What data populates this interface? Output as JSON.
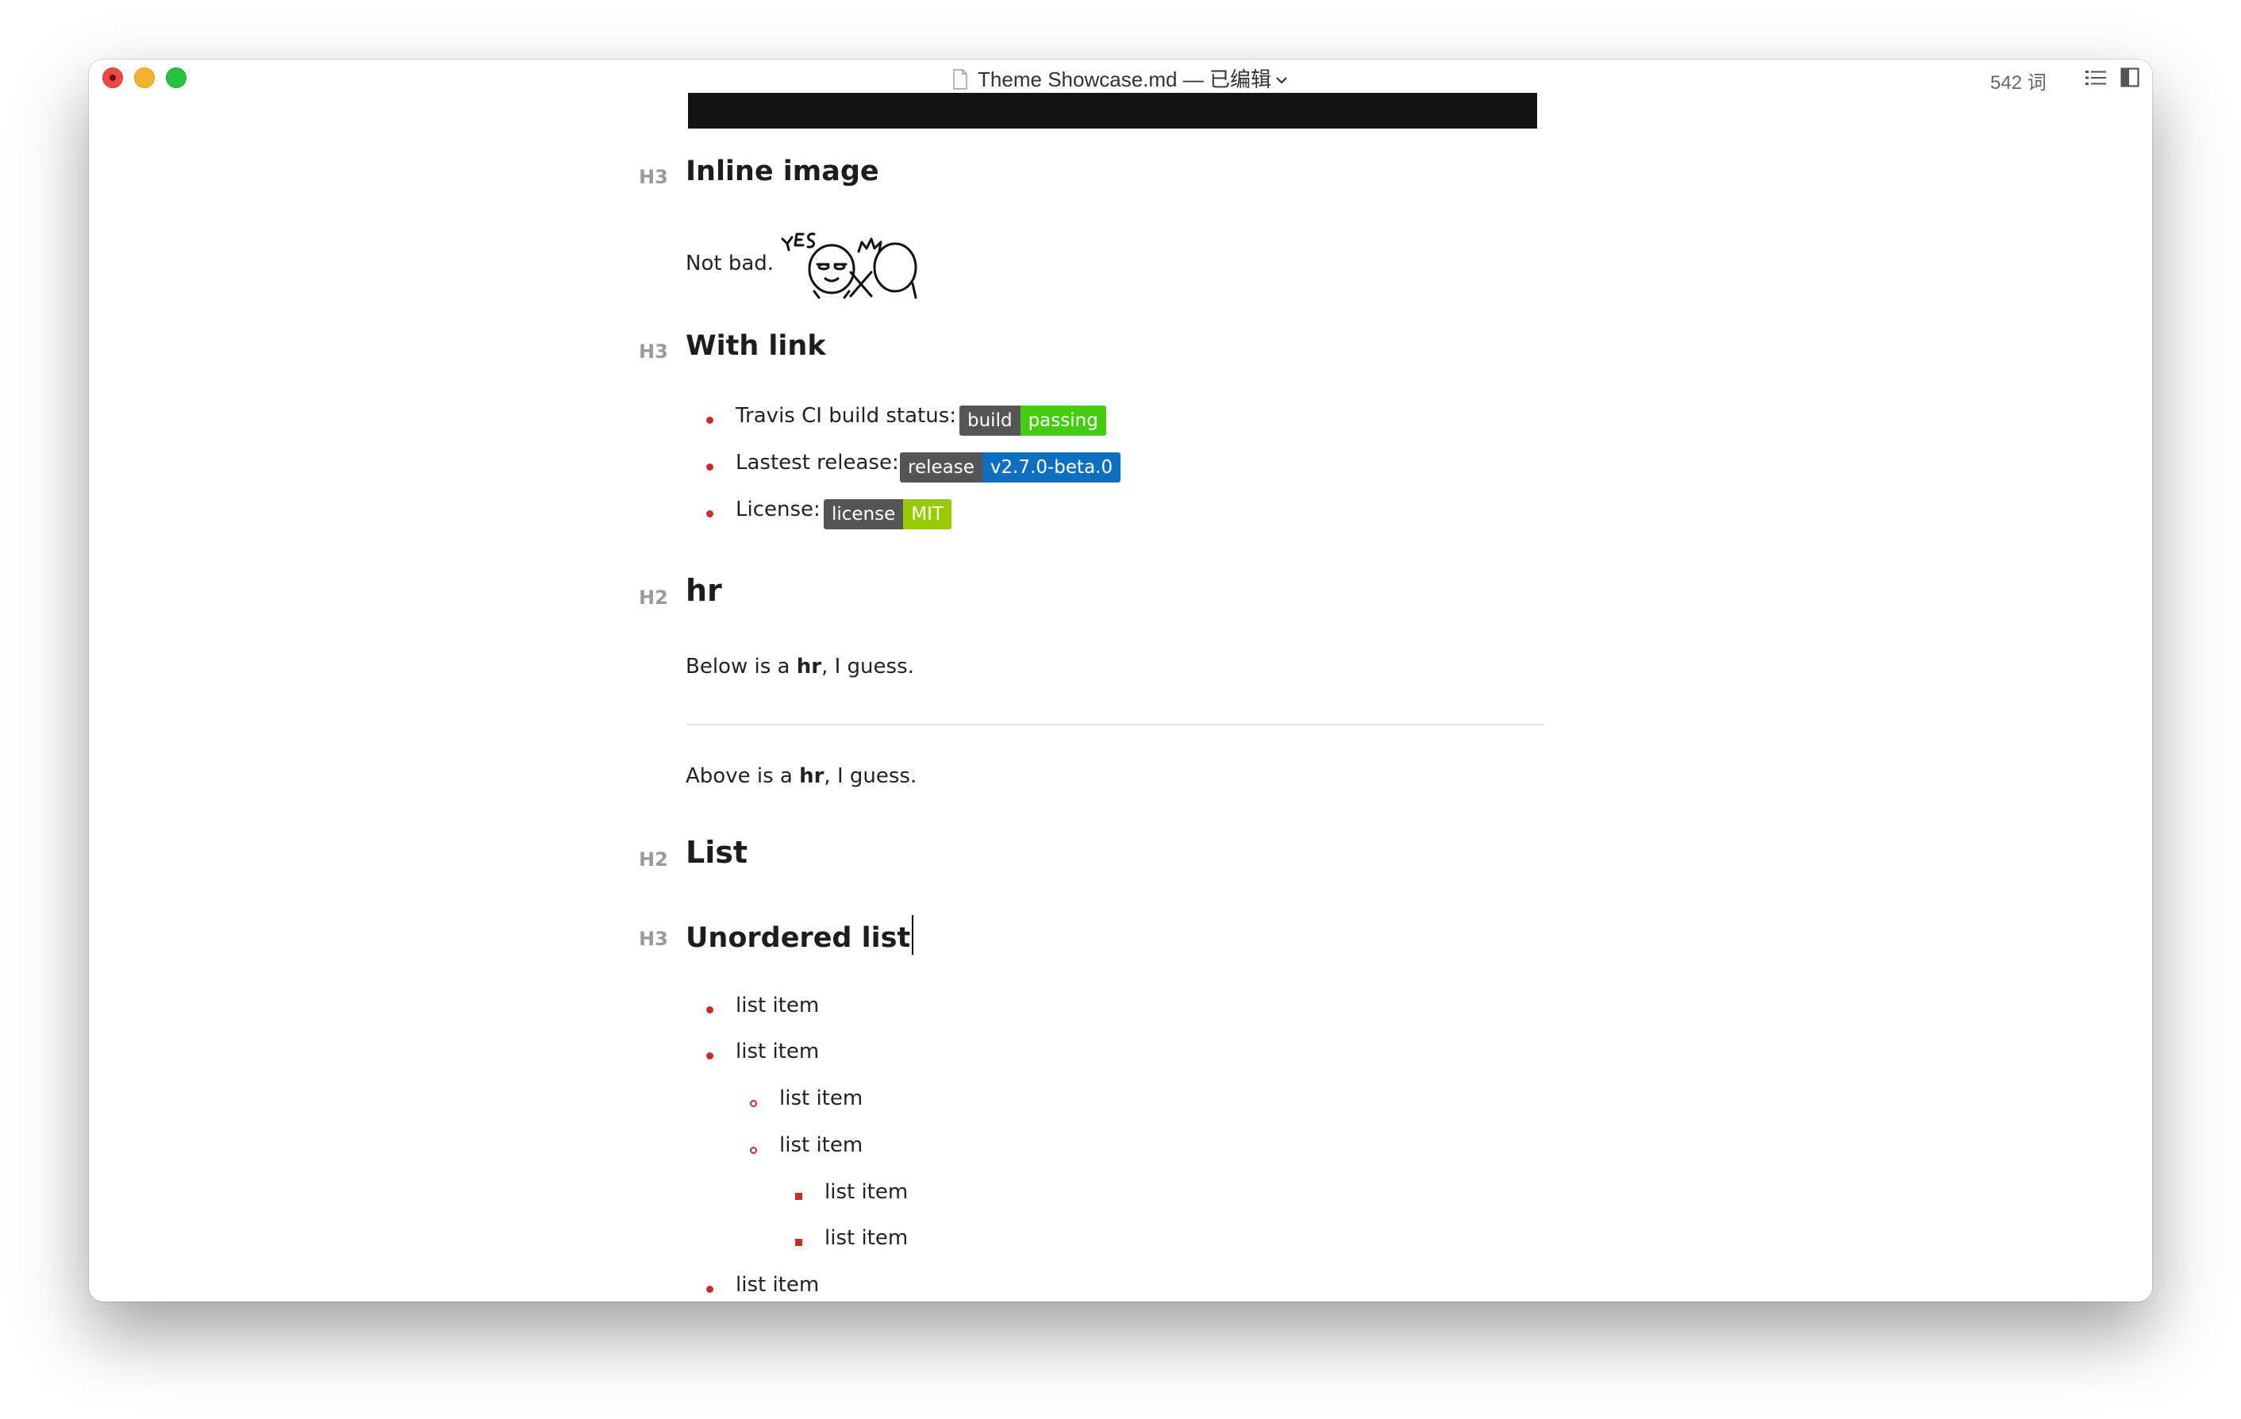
{
  "window": {
    "title": "Theme Showcase.md — 已编辑",
    "word_count": "542 词"
  },
  "doc": {
    "inline_image": {
      "mark": "H3",
      "heading": "Inline image",
      "text": "Not bad."
    },
    "with_link": {
      "mark": "H3",
      "heading": "With link",
      "items": [
        {
          "text": "Travis CI build status:",
          "badge_left": "build",
          "badge_right": "passing",
          "badge_color": "#44cc11"
        },
        {
          "text": "Lastest release:",
          "badge_left": "release",
          "badge_right": "v2.7.0-beta.0",
          "badge_color": "#0e6fc1"
        },
        {
          "text": "License:",
          "badge_left": "license",
          "badge_right": "MIT",
          "badge_color": "#97ca00"
        }
      ]
    },
    "hr_section": {
      "mark": "H2",
      "heading": "hr",
      "below": {
        "before": "Below is a ",
        "bold": "hr",
        "after": ", I guess."
      },
      "above": {
        "before": "Above is a ",
        "bold": "hr",
        "after": ", I guess."
      }
    },
    "list_section": {
      "mark": "H2",
      "heading": "List"
    },
    "unordered": {
      "mark": "H3",
      "heading": "Unordered list",
      "items": [
        "list item",
        "list item",
        "list item",
        "list item",
        "list item",
        "list item",
        "list item"
      ]
    }
  },
  "colors": {
    "bullet": "#c62e2e",
    "badge_dark": "#555555"
  }
}
